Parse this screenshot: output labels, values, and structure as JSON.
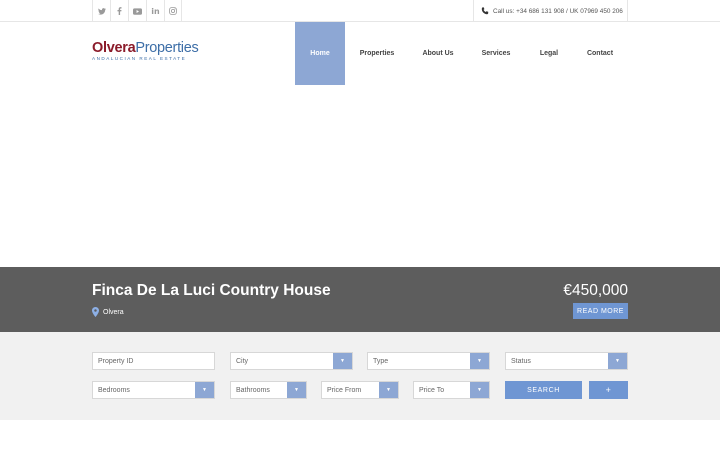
{
  "topbar": {
    "social": [
      {
        "name": "twitter-icon",
        "glyph": "🐦"
      },
      {
        "name": "facebook-icon",
        "glyph": "f"
      },
      {
        "name": "youtube-icon",
        "glyph": "▶"
      },
      {
        "name": "linkedin-icon",
        "glyph": "in"
      },
      {
        "name": "instagram-icon",
        "glyph": "◎"
      }
    ],
    "call_text": "Call us: +34 686 131 908 / UK 07969 450 206"
  },
  "logo": {
    "part1": "Olvera",
    "part2": "Properties",
    "tagline": "ANDALUCIAN REAL ESTATE"
  },
  "nav": {
    "home": "Home",
    "properties": "Properties",
    "about": "About Us",
    "services": "Services",
    "legal": "Legal",
    "contact": "Contact"
  },
  "hero": {
    "title": "Finca De La Luci Country House",
    "location": "Olvera",
    "price": "€450,000",
    "read_more": "READ MORE"
  },
  "search": {
    "property_id": "Property ID",
    "city": "City",
    "type": "Type",
    "status": "Status",
    "bedrooms": "Bedrooms",
    "bathrooms": "Bathrooms",
    "price_from": "Price From",
    "price_to": "Price To",
    "search_label": "SEARCH",
    "plus_label": "+"
  },
  "colors": {
    "accent": "#6f96d3",
    "nav_active": "#8da7d4",
    "hero_bg": "#5d5d5d",
    "brand_red": "#8b1b2a",
    "brand_blue": "#3d6ea7"
  }
}
